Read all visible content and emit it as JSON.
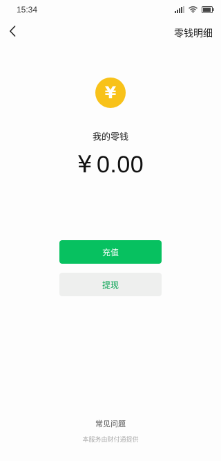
{
  "status_bar": {
    "time": "15:34",
    "icons": [
      "signal-icon",
      "wifi-icon",
      "battery-icon"
    ]
  },
  "nav": {
    "back_icon": "chevron-left-icon",
    "action_label": "零钱明细"
  },
  "balance": {
    "icon": "yen-coin-icon",
    "icon_glyph": "¥",
    "label": "我的零钱",
    "currency_symbol": "¥",
    "amount": "0.00"
  },
  "actions": {
    "recharge_label": "充值",
    "withdraw_label": "提现"
  },
  "footer": {
    "faq_label": "常见问题",
    "provider_note": "本服务由财付通提供"
  },
  "colors": {
    "primary_green": "#07c160",
    "coin_yellow": "#f8c21a",
    "withdraw_bg": "#eeefee"
  }
}
